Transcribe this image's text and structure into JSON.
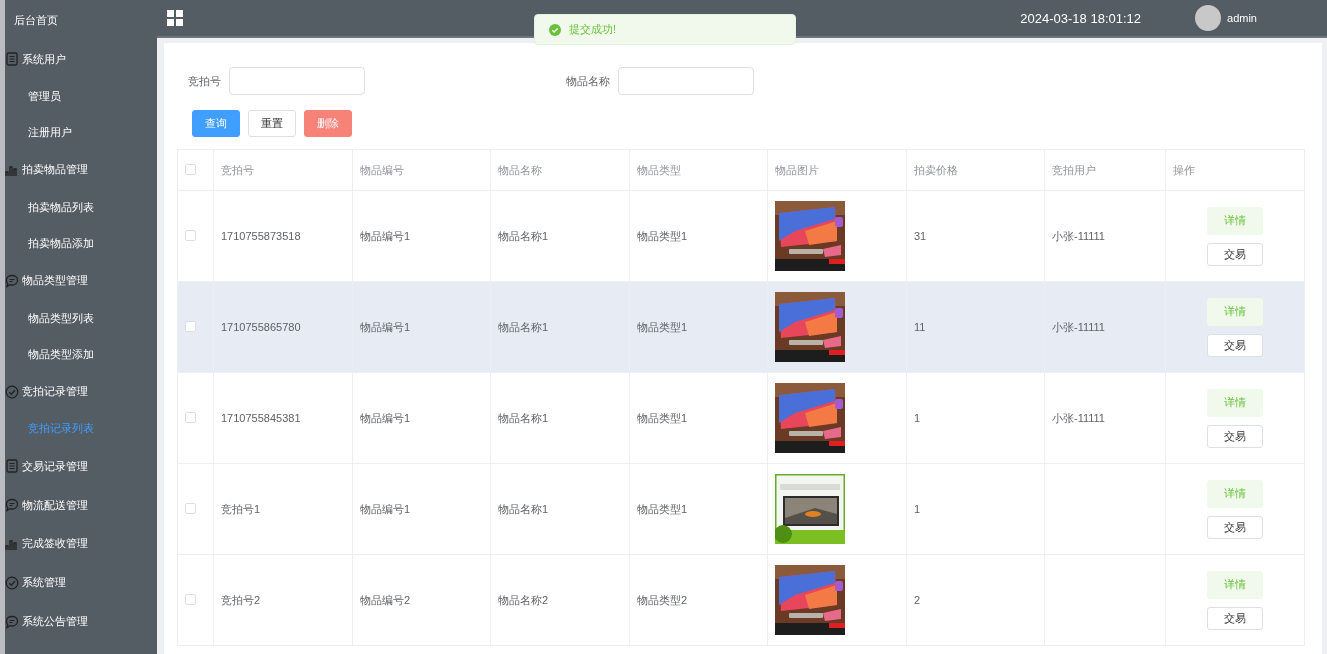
{
  "sidebar": {
    "items": [
      {
        "label": "后台首页",
        "kind": "plain"
      },
      {
        "label": "系统用户",
        "kind": "list",
        "children": [
          {
            "label": "管理员",
            "selected": false
          },
          {
            "label": "注册用户",
            "selected": false
          }
        ]
      },
      {
        "label": "拍卖物品管理",
        "kind": "chart",
        "children": [
          {
            "label": "拍卖物品列表",
            "selected": false
          },
          {
            "label": "拍卖物品添加",
            "selected": false
          }
        ]
      },
      {
        "label": "物品类型管理",
        "kind": "chat",
        "children": [
          {
            "label": "物品类型列表",
            "selected": false
          },
          {
            "label": "物品类型添加",
            "selected": false
          }
        ]
      },
      {
        "label": "竞拍记录管理",
        "kind": "check",
        "children": [
          {
            "label": "竞拍记录列表",
            "selected": true
          }
        ]
      },
      {
        "label": "交易记录管理",
        "kind": "list"
      },
      {
        "label": "物流配送管理",
        "kind": "chat"
      },
      {
        "label": "完成签收管理",
        "kind": "chart"
      },
      {
        "label": "系统管理",
        "kind": "check"
      },
      {
        "label": "系统公告管理",
        "kind": "chat"
      }
    ]
  },
  "header": {
    "datetime": "2024-03-18 18:01:12",
    "user": "admin"
  },
  "toast": {
    "message": "提交成功!"
  },
  "search": {
    "fields": [
      {
        "label": "竞拍号"
      },
      {
        "label": "物品名称"
      }
    ],
    "buttons": [
      {
        "label": "查询",
        "kind": "primary"
      },
      {
        "label": "重置",
        "kind": "default"
      },
      {
        "label": "删除",
        "kind": "danger"
      }
    ]
  },
  "table": {
    "select_all_checked": false,
    "columns": [
      "竞拍号",
      "物品编号",
      "物品名称",
      "物品类型",
      "物品图片",
      "拍卖价格",
      "竞拍用户",
      "操作"
    ],
    "rows": [
      {
        "checked": false,
        "highlighted": false,
        "cells": [
          "1710755873518",
          "物品编号1",
          "物品名称1",
          "物品类型1",
          {
            "kind": "picture"
          },
          "31",
          "小张-11111"
        ],
        "actions": [
          "详情",
          "交易"
        ]
      },
      {
        "checked": false,
        "highlighted": true,
        "cells": [
          "1710755865780",
          "物品编号1",
          "物品名称1",
          "物品类型1",
          {
            "kind": "picture"
          },
          "11",
          "小张-11111"
        ],
        "actions": [
          "详情",
          "交易"
        ]
      },
      {
        "checked": false,
        "highlighted": false,
        "cells": [
          "1710755845381",
          "物品编号1",
          "物品名称1",
          "物品类型1",
          {
            "kind": "picture"
          },
          "1",
          "小张-11111"
        ],
        "actions": [
          "详情",
          "交易"
        ]
      },
      {
        "checked": false,
        "highlighted": false,
        "cells": [
          "竞拍号1",
          "物品编号1",
          "物品名称1",
          "物品类型1",
          {
            "kind": "picture"
          },
          "1",
          ""
        ],
        "actions": [
          "详情",
          "交易"
        ]
      },
      {
        "checked": false,
        "highlighted": false,
        "cells": [
          "竞拍号2",
          "物品编号2",
          "物品名称2",
          "物品类型2",
          {
            "kind": "picture"
          },
          "2",
          ""
        ],
        "actions": [
          "详情",
          "交易"
        ]
      }
    ]
  }
}
